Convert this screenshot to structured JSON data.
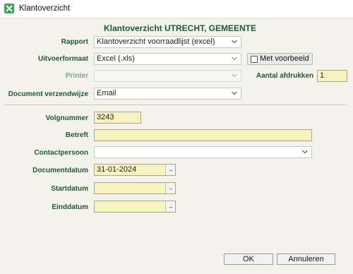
{
  "window": {
    "title": "Klantoverzicht"
  },
  "heading": "Klantoverzicht UTRECHT, GEMEENTE",
  "form": {
    "rapport": {
      "label": "Rapport",
      "value": "Klantoverzicht voorraadlijst (excel)"
    },
    "uitvoerformaat": {
      "label": "Uitvoerformaat",
      "value": "Excel (.xls)"
    },
    "met_voorbeeld": {
      "label": "Met voorbeeld",
      "checked": false
    },
    "printer": {
      "label": "Printer",
      "value": ""
    },
    "aantal_afdrukken": {
      "label": "Aantal afdrukken",
      "value": "1"
    },
    "document_verzendwijze": {
      "label": "Document verzendwijze",
      "value": "Email"
    },
    "volgnummer": {
      "label": "Volgnummer",
      "value": "3243"
    },
    "betreft": {
      "label": "Betreft",
      "value": ""
    },
    "contactpersoon": {
      "label": "Contactpersoon",
      "value": ""
    },
    "documentdatum": {
      "label": "Documentdatum",
      "value": "31-01-2024"
    },
    "startdatum": {
      "label": "Startdatum",
      "value": ""
    },
    "einddatum": {
      "label": "Einddatum",
      "value": ""
    },
    "date_button": "..."
  },
  "buttons": {
    "ok": "OK",
    "cancel": "Annuleren"
  },
  "colors": {
    "label": "#1f5a35",
    "required_field": "#f9f3c0",
    "heading": "#1f5a35"
  },
  "icons": {
    "app": "excel-sheet-icon",
    "dropdown": "chevron-down-icon"
  }
}
